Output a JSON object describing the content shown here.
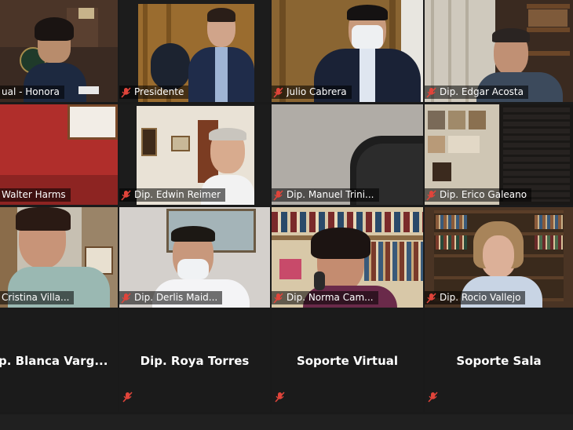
{
  "participants": [
    {
      "name": "ual -  Honora"
    },
    {
      "name": "Presidente"
    },
    {
      "name": "Julio Cabrera"
    },
    {
      "name": "Dip. Edgar Acosta"
    },
    {
      "name": "Walter Harms"
    },
    {
      "name": "Dip. Edwin Reimer"
    },
    {
      "name": "Dip. Manuel Trini..."
    },
    {
      "name": "Dip. Erico Galeano"
    },
    {
      "name": "Cristina Villa..."
    },
    {
      "name": "Dip. Derlis Maid..."
    },
    {
      "name": "Dip. Norma Cam..."
    },
    {
      "name": "Dip. Rocio Vallejo"
    },
    {
      "name": "p.  Blanca  Varg..."
    },
    {
      "name": "Dip. Roya Torres"
    },
    {
      "name": "Soporte Virtual"
    },
    {
      "name": "Soporte Sala"
    }
  ],
  "colors": {
    "active_speaker_border": "#d8e63a",
    "muted_icon": "#e0443a",
    "tile_background": "#1c1c1c"
  },
  "icons": {
    "muted": "mic-muted-icon"
  }
}
